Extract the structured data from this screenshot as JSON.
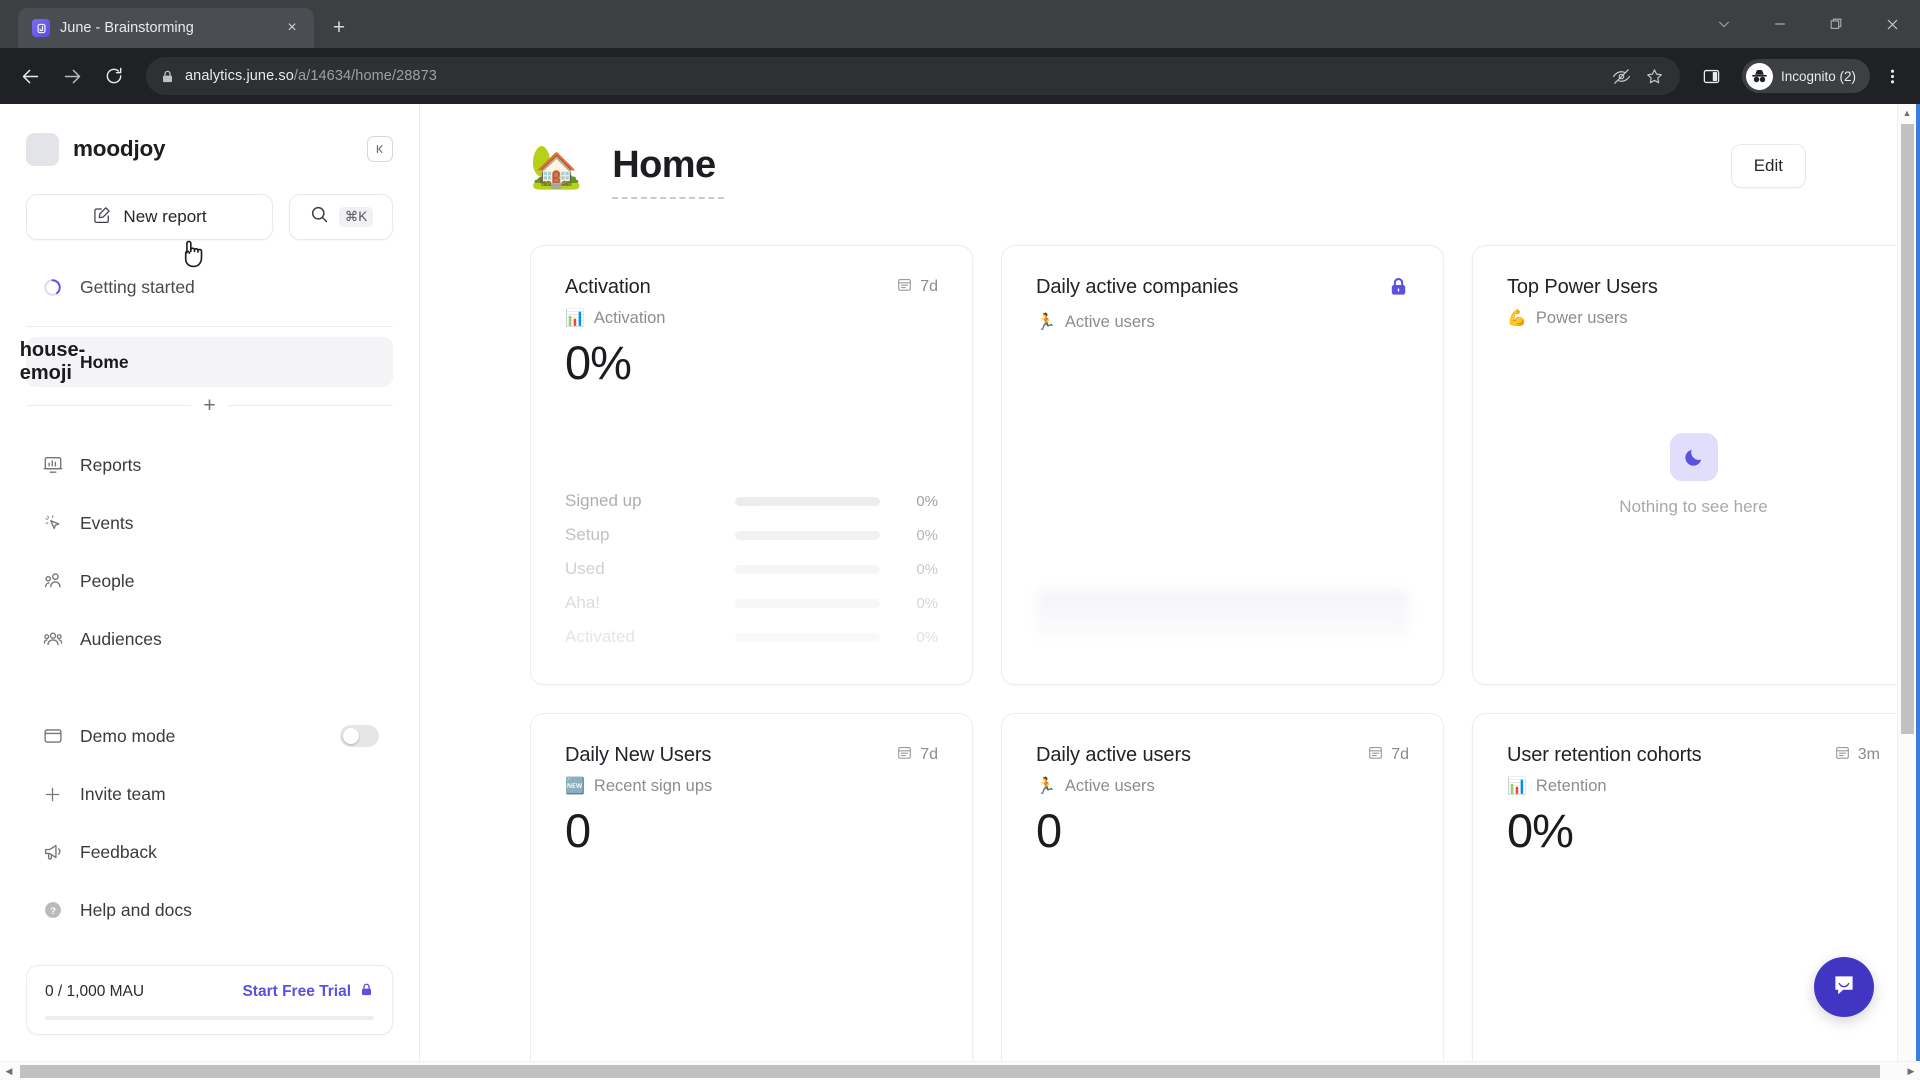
{
  "browser": {
    "tab": {
      "title": "June - Brainstorming",
      "favicon": "june-logo-icon",
      "close_label": "×"
    },
    "new_tab_label": "+",
    "window_controls": {
      "minimize": "–",
      "maximize": "❐",
      "close": "✕",
      "tab_search": "∨"
    },
    "nav": {
      "back": "←",
      "forward": "→",
      "reload": "↻"
    },
    "omnibox": {
      "host": "analytics.june.so",
      "path": "/a/14634/home/28873",
      "tracking_protection_icon": "eye-slash-icon",
      "bookmark_icon": "star-icon"
    },
    "side_panel_icon": "side-panel-icon",
    "profile": {
      "label": "Incognito (2)",
      "icon": "incognito-icon"
    },
    "menu_icon": "kebab-menu-icon"
  },
  "sidebar": {
    "workspace": {
      "name": "moodjoy",
      "avatar": "workspace-avatar"
    },
    "collapse_label": "|◀",
    "new_report": {
      "label": "New report",
      "icon": "edit-square-icon"
    },
    "search": {
      "icon": "search-icon",
      "shortcut": "⌘K"
    },
    "getting_started": {
      "label": "Getting started",
      "icon": "progress-ring-icon"
    },
    "primary_items": [
      {
        "label": "Home",
        "icon": "house-emoji",
        "active": true
      }
    ],
    "add_label": "+",
    "nav_items": [
      {
        "label": "Reports",
        "icon": "reports-icon"
      },
      {
        "label": "Events",
        "icon": "events-cursor-icon"
      },
      {
        "label": "People",
        "icon": "people-icon"
      },
      {
        "label": "Audiences",
        "icon": "audiences-icon"
      }
    ],
    "bottom_items": [
      {
        "label": "Demo mode",
        "icon": "window-icon",
        "toggle": true,
        "toggle_on": false
      },
      {
        "label": "Invite team",
        "icon": "plus-icon"
      },
      {
        "label": "Feedback",
        "icon": "megaphone-icon"
      },
      {
        "label": "Help and docs",
        "icon": "question-circle-icon"
      }
    ],
    "mau": {
      "count": "0 / 1,000 MAU",
      "trial_label": "Start Free Trial",
      "lock_icon": "lock-icon",
      "progress_percent": 0
    }
  },
  "main": {
    "emoji": "🏡",
    "title": "Home",
    "edit_label": "Edit",
    "cards": [
      {
        "title": "Activation",
        "subtitle": "Activation",
        "sub_emoji": "📊",
        "badge": "7d",
        "badge_icon": "calendar-icon",
        "value": "0%",
        "funnel": [
          {
            "label": "Signed up",
            "value": "0%",
            "bar_percent": 100
          },
          {
            "label": "Setup",
            "value": "0%",
            "bar_percent": 100
          },
          {
            "label": "Used",
            "value": "0%",
            "bar_percent": 100
          },
          {
            "label": "Aha!",
            "value": "0%",
            "bar_percent": 100
          },
          {
            "label": "Activated",
            "value": "0%",
            "bar_percent": 100
          }
        ]
      },
      {
        "title": "Daily active companies",
        "subtitle": "Active users",
        "sub_emoji": "🏃",
        "locked": true,
        "lock_icon": "lock-icon"
      },
      {
        "title": "Top Power Users",
        "subtitle": "Power users",
        "sub_emoji": "💪",
        "empty_text": "Nothing to see here",
        "empty_icon": "moon-icon"
      },
      {
        "title": "Daily New Users",
        "subtitle": "Recent sign ups",
        "sub_emoji": "🆕",
        "badge": "7d",
        "badge_icon": "calendar-icon",
        "value": "0"
      },
      {
        "title": "Daily active users",
        "subtitle": "Active users",
        "sub_emoji": "🏃",
        "badge": "7d",
        "badge_icon": "calendar-icon",
        "value": "0"
      },
      {
        "title": "User retention cohorts",
        "subtitle": "Retention",
        "sub_emoji": "📊",
        "badge": "3m",
        "badge_icon": "calendar-icon",
        "value": "0%"
      }
    ],
    "intercom_icon": "chat-bubble-icon"
  },
  "colors": {
    "accent": "#5b50e0",
    "intercom": "#4136c4",
    "chrome_tabstrip": "#3c4043",
    "chrome_toolbar": "#202124",
    "focus_border": "#3b7ddd"
  }
}
